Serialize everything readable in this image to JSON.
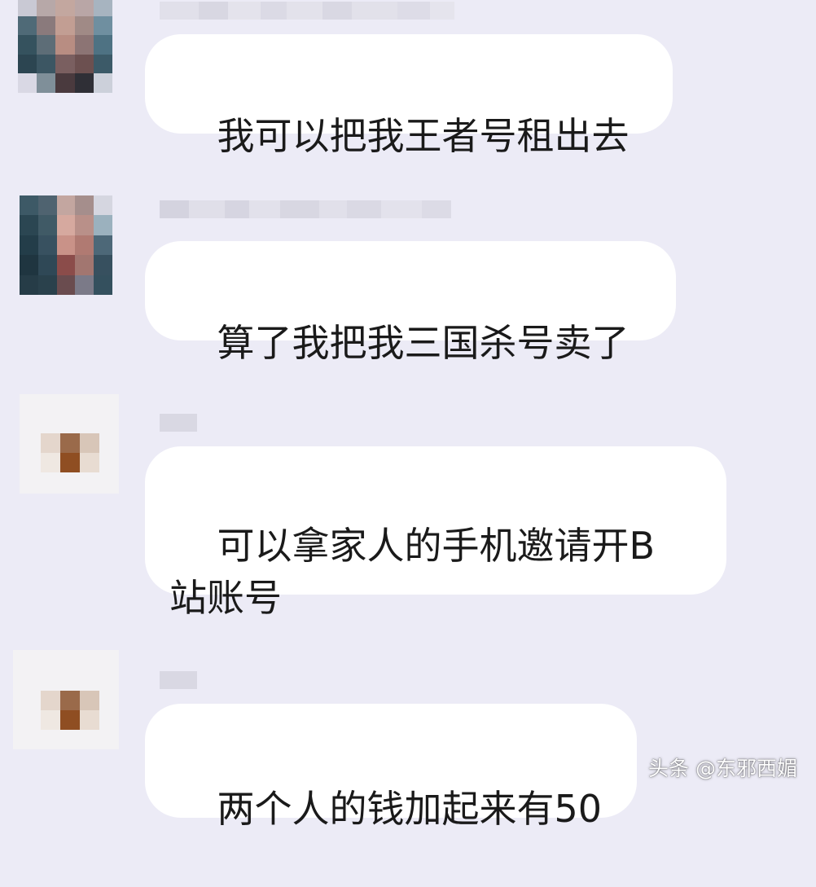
{
  "colors": {
    "background": "#ecebf6",
    "bubble": "#ffffff",
    "text": "#1a1a1a"
  },
  "messages": [
    {
      "text": "我可以把我王者号租出去",
      "avatar": "pixelated-photo"
    },
    {
      "text": "算了我把我三国杀号卖了",
      "avatar": "pixelated-photo"
    },
    {
      "text": "可以拿家人的手机邀请开B站账号",
      "avatar": "pixelated-icon"
    },
    {
      "text": "两个人的钱加起来有50",
      "avatar": "pixelated-icon"
    }
  ],
  "watermark": {
    "text": "头条 @东邪西媚"
  }
}
